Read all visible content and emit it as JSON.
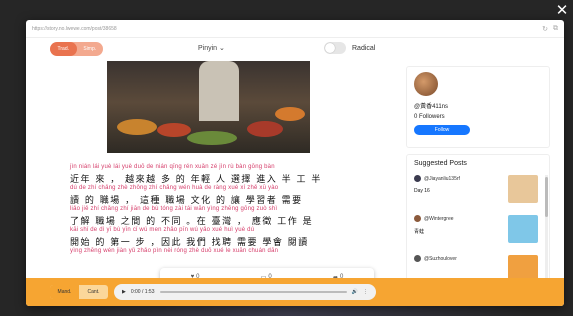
{
  "url": "https://story.no.lwewe.com/post/38658",
  "toolbar": {
    "trad_label": "Trad.",
    "simp_label": "Simp.",
    "pinyin_label": "Pinyin",
    "radical_label": "Radical"
  },
  "lines": [
    {
      "py": "jìn nián lái     yuè lái yuè  duō  de  nián qīng  rén  xuǎn zé  jìn rù  bàn  gōng  bàn",
      "hz": "近年 來 ， 越來越 多 的 年輕 人 選擇 進入 半 工 半"
    },
    {
      "py": "dú   de   zhí chǎng      zhè zhǒng  zhí chǎng  wén huà  de  ràng  xué xí  zhě  xū yào",
      "hz": "讀 的  職場  ， 這種  職場  文化 的 讓 學習者 需要"
    },
    {
      "py": "liǎo jiě  zhí chǎng  zhí jiān  de  bù tóng      zài  tái wān      yìng zhēng  gōng zuò  shì",
      "hz": "了解  職場  之間 的 不同 。在 臺灣 ，  應徵  工作 是"
    },
    {
      "py": "kāi shǐ  de  dì yī    bù        yīn cǐ  wú men  zhǎo pīn  wú yǎo  xué huì  yuè dú",
      "hz": "開始 的 第一 步 ，因此 我們 找聘 需要 學會 閱讀"
    },
    {
      "py": "yìng zhēng  wén jiàn  yǔ  zhǎo pìn  nèi róng      zhè  duō  xué  le  xuān chuán  dān",
      "hz": ""
    }
  ],
  "reactions": {
    "likes": "0",
    "comments": "0",
    "shares": "0"
  },
  "profile": {
    "handle": "@黃香411ns",
    "followers": "0 Followers",
    "follow_label": "Follow"
  },
  "suggested": {
    "title": "Suggested Posts",
    "posts": [
      {
        "user": "@Jiayanliu135rf",
        "title": "Day 16",
        "dot_color": "#3b3b4f",
        "thumb_color": "#e8c79a"
      },
      {
        "user": "@Wintergree",
        "title": "青蛙",
        "dot_color": "#8b5a3c",
        "thumb_color": "#7fc7e8"
      },
      {
        "user": "@Suzhoulover",
        "title": "",
        "dot_color": "#555555",
        "thumb_color": "#f0a040"
      }
    ]
  },
  "audio": {
    "mand_label": "Mand.",
    "cant_label": "Cant.",
    "time": "0:00 / 1:53",
    "progress": 0.0
  },
  "colors": {
    "accent": "#e9734f",
    "audio_bar": "#f6a532",
    "pinyin": "#d63e6b",
    "follow": "#1677ff"
  }
}
